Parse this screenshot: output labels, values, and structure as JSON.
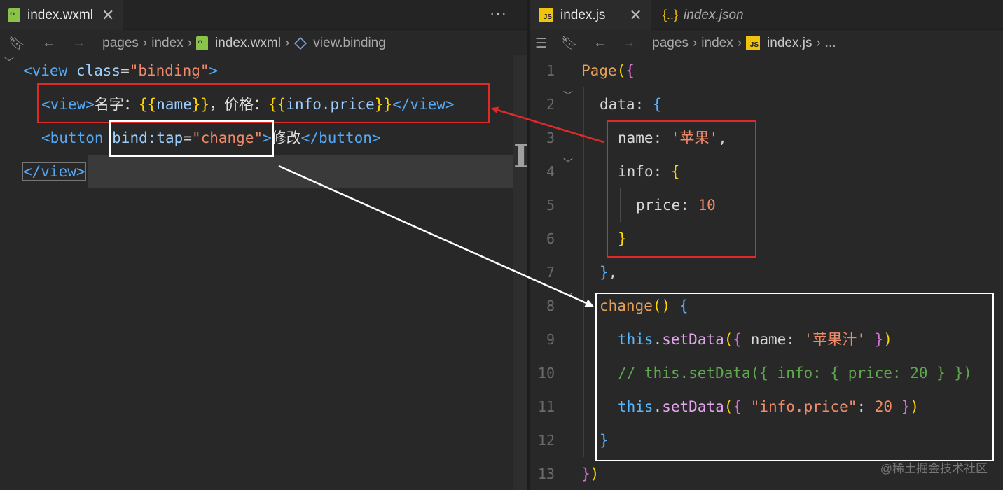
{
  "left_editor": {
    "tab": {
      "label": "index.wxml",
      "close": "✕",
      "more": "···"
    },
    "breadcrumb": [
      "pages",
      "index",
      "index.wxml",
      "view.binding"
    ],
    "lines": [
      {
        "tokens": [
          "<view ",
          "class",
          "=",
          "\"binding\"",
          ">"
        ]
      },
      {
        "tokens": [
          "<view>",
          "名字：",
          "{{",
          "name",
          "}}",
          "，价格：",
          "{{",
          "info.price",
          "}}",
          "</view>"
        ]
      },
      {
        "tokens": [
          "<button ",
          "bind:tap",
          "=",
          "\"change\"",
          ">",
          "修改",
          "</button>"
        ]
      },
      {
        "tokens": [
          "</view>"
        ]
      }
    ]
  },
  "right_editor": {
    "tabs": [
      {
        "label": "index.js",
        "close": "✕",
        "active": true
      },
      {
        "label": "index.json",
        "active": false
      }
    ],
    "breadcrumb": [
      "pages",
      "index",
      "index.js",
      "..."
    ],
    "line_numbers": [
      "1",
      "2",
      "3",
      "4",
      "5",
      "6",
      "7",
      "8",
      "9",
      "10",
      "11",
      "12",
      "13"
    ],
    "lines": [
      [
        "Page",
        "(",
        "{"
      ],
      [
        "data",
        ": ",
        "{"
      ],
      [
        "name",
        ": ",
        "'苹果'",
        ","
      ],
      [
        "info",
        ": ",
        "{"
      ],
      [
        "price",
        ": ",
        "10"
      ],
      [
        "}"
      ],
      [
        "}",
        ","
      ],
      [
        "change",
        "(",
        ")",
        " ",
        "{"
      ],
      [
        "this",
        ".",
        "setData",
        "(",
        "{",
        " name",
        ": ",
        "'苹果汁'",
        " ",
        "}",
        ")"
      ],
      [
        "// this.setData({ info: { price: 20 } })"
      ],
      [
        "this",
        ".",
        "setData",
        "(",
        "{",
        " ",
        "\"info.price\"",
        ": ",
        "20",
        " ",
        "}",
        ")"
      ],
      [
        "}"
      ],
      [
        "}",
        ")"
      ]
    ]
  },
  "watermark": "@稀土掘金技术社区",
  "colors": {
    "red_box": "#e02a2a",
    "white_box": "#ffffff"
  }
}
